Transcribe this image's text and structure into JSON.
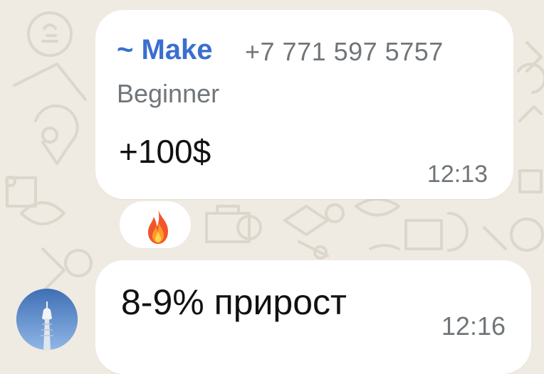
{
  "chat": {
    "messages": [
      {
        "sender_name": "~ Make",
        "sender_phone": "+7 771 597 5757",
        "sender_role": "Beginner",
        "text": "+100$",
        "time": "12:13",
        "reaction": "fire-emoji"
      },
      {
        "text": "8-9% прирост",
        "time": "12:16"
      }
    ]
  },
  "colors": {
    "background": "#efeae2",
    "bubble": "#ffffff",
    "sender_name": "#3a6fd0",
    "meta_text": "#707579"
  }
}
